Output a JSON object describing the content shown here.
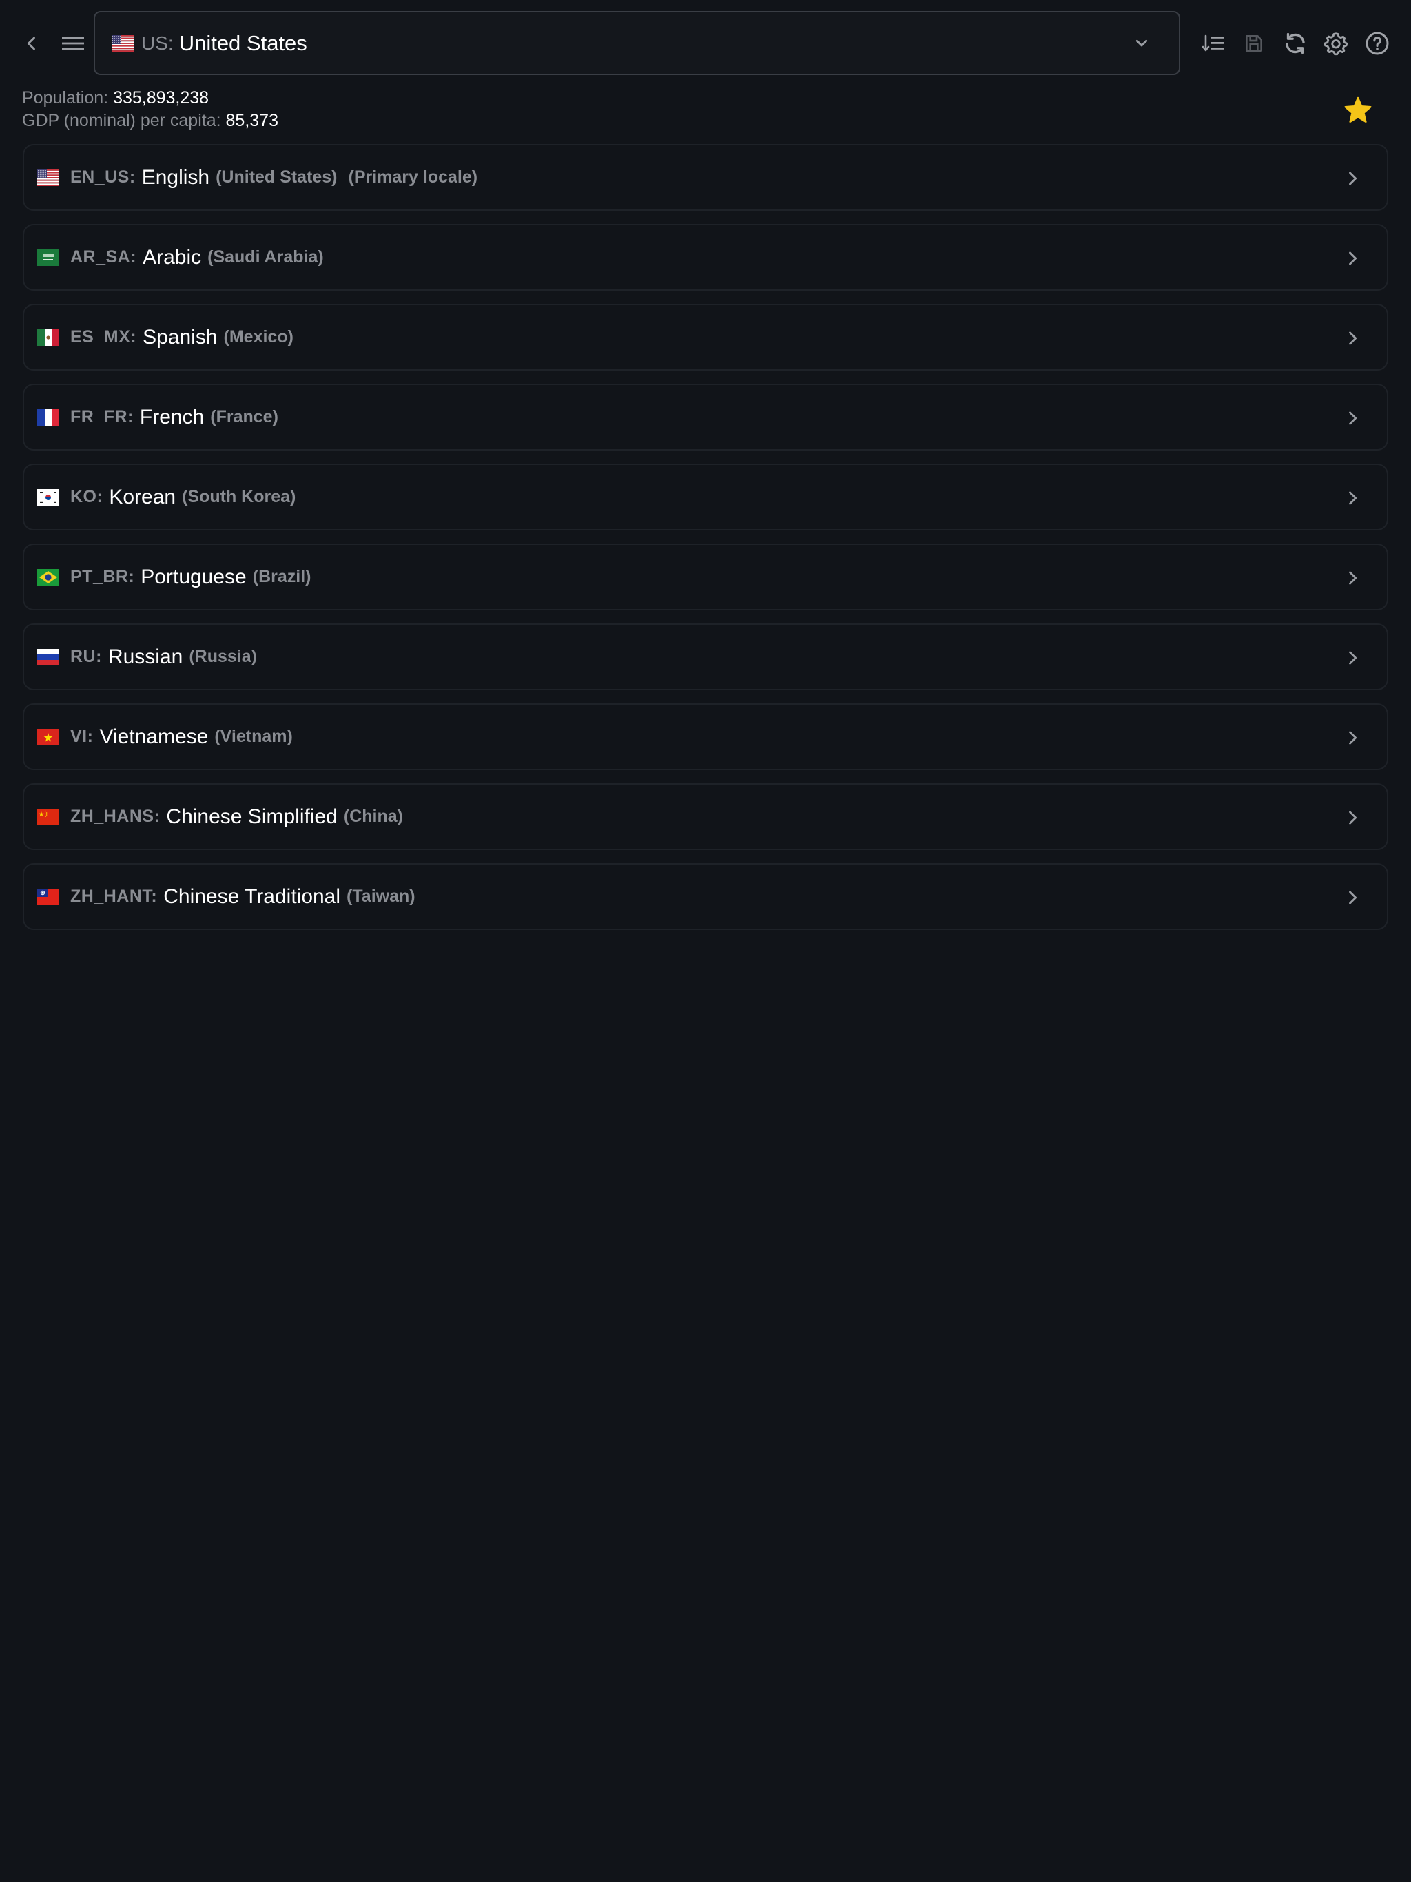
{
  "header": {
    "country_select": {
      "code": "US:",
      "name": "United States",
      "flag": "flag-us-icon"
    },
    "toolbar": [
      "sort-icon",
      "save-icon",
      "refresh-icon",
      "settings-icon",
      "help-icon"
    ]
  },
  "stats": {
    "population_label": "Population:",
    "population_value": "335,893,238",
    "gdp_label": "GDP (nominal) per capita:",
    "gdp_value": "85,373"
  },
  "favorite": {
    "icon": "star-icon",
    "color": "#f5c518"
  },
  "locales": [
    {
      "code": "EN_US:",
      "name": "English",
      "region": "(United States)",
      "extra": "(Primary locale)",
      "flag": "us"
    },
    {
      "code": "AR_SA:",
      "name": "Arabic",
      "region": "(Saudi Arabia)",
      "flag": "sa"
    },
    {
      "code": "ES_MX:",
      "name": "Spanish",
      "region": "(Mexico)",
      "flag": "mx"
    },
    {
      "code": "FR_FR:",
      "name": "French",
      "region": "(France)",
      "flag": "fr"
    },
    {
      "code": "KO:",
      "name": "Korean",
      "region": "(South Korea)",
      "flag": "kr"
    },
    {
      "code": "PT_BR:",
      "name": "Portuguese",
      "region": "(Brazil)",
      "flag": "br"
    },
    {
      "code": "RU:",
      "name": "Russian",
      "region": "(Russia)",
      "flag": "ru"
    },
    {
      "code": "VI:",
      "name": "Vietnamese",
      "region": "(Vietnam)",
      "flag": "vn"
    },
    {
      "code": "ZH_HANS:",
      "name": "Chinese Simplified",
      "region": "(China)",
      "flag": "cn"
    },
    {
      "code": "ZH_HANT:",
      "name": "Chinese Traditional",
      "region": "(Taiwan)",
      "flag": "tw"
    }
  ],
  "colors": {
    "background": "#111419",
    "muted_text": "#8a8d93",
    "border": "#1e2228"
  }
}
